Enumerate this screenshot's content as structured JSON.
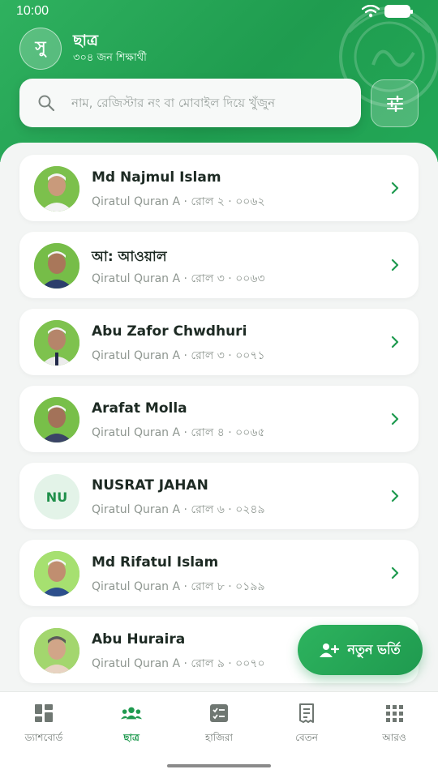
{
  "status_bar": {
    "time": "10:00"
  },
  "header": {
    "avatar_letter": "সু",
    "title": "ছাত্র",
    "subtitle": "৩০৪ জন শিক্ষার্থী"
  },
  "search": {
    "placeholder": "নাম, রেজিস্টার নং বা মোবাইল দিয়ে খুঁজুন",
    "value": ""
  },
  "students": [
    {
      "name": "Md Najmul Islam",
      "meta": "Qiratul Quran A · রোল ২ · ০০৬২",
      "has_photo": true,
      "initials": ""
    },
    {
      "name": "আ: আওয়াল",
      "meta": "Qiratul Quran A · রোল ৩ · ০০৬৩",
      "has_photo": true,
      "initials": ""
    },
    {
      "name": "Abu Zafor Chwdhuri",
      "meta": "Qiratul Quran A · রোল ৩ · ০০৭১",
      "has_photo": true,
      "initials": ""
    },
    {
      "name": "Arafat Molla",
      "meta": "Qiratul Quran A · রোল ৪ · ০০৬৫",
      "has_photo": true,
      "initials": ""
    },
    {
      "name": "NUSRAT JAHAN",
      "meta": "Qiratul Quran A · রোল ৬ · ০২৪৯",
      "has_photo": false,
      "initials": "NU"
    },
    {
      "name": "Md Rifatul Islam",
      "meta": "Qiratul Quran A · রোল ৮ · ০১৯৯",
      "has_photo": true,
      "initials": ""
    },
    {
      "name": "Abu Huraira",
      "meta": "Qiratul Quran A · রোল ৯ · ০০৭০",
      "has_photo": true,
      "initials": ""
    }
  ],
  "fab": {
    "label": "নতুন ভর্তি",
    "icon": "add-person-icon"
  },
  "bottom_nav": [
    {
      "label": "ড্যাশবোর্ড",
      "icon": "dashboard-icon",
      "active": false
    },
    {
      "label": "ছাত্র",
      "icon": "students-icon",
      "active": true
    },
    {
      "label": "হাজিরা",
      "icon": "attendance-icon",
      "active": false
    },
    {
      "label": "বেতন",
      "icon": "fees-icon",
      "active": false
    },
    {
      "label": "আরও",
      "icon": "more-grid-icon",
      "active": false
    }
  ],
  "colors": {
    "primary": "#1f9a4f",
    "header": "#2fb15f",
    "text": "#1d2a23",
    "muted": "#8e9690"
  }
}
